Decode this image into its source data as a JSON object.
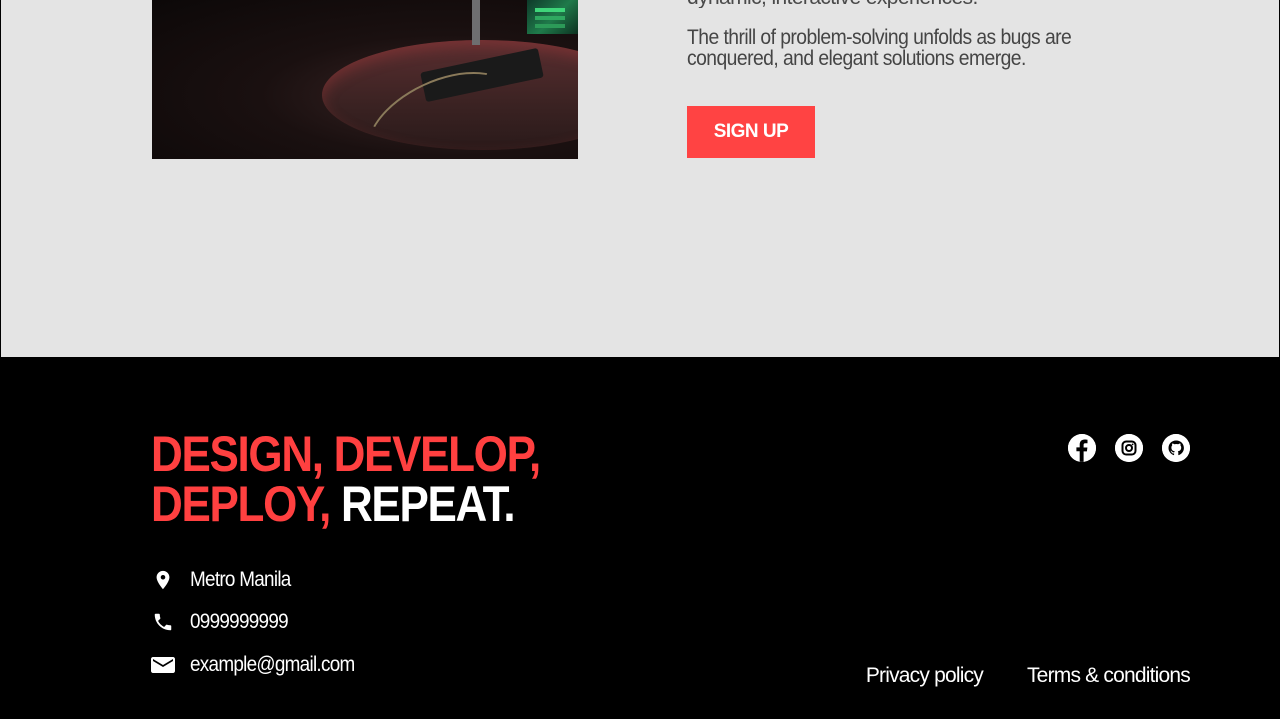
{
  "content": {
    "paragraph_cut": "dynamic, interactive experiences.",
    "paragraph": "The thrill of problem-solving unfolds as bugs are conquered, and elegant solutions emerge.",
    "signup_label": "SIGN UP"
  },
  "footer": {
    "tagline_red_1": "DESIGN, DEVELOP,",
    "tagline_red_2": "DEPLOY,",
    "tagline_white": "REPEAT.",
    "location": "Metro Manila",
    "phone": "0999999999",
    "email": "example@gmail.com",
    "privacy_label": "Privacy policy",
    "terms_label": "Terms & conditions",
    "socials": [
      "facebook-icon",
      "instagram-icon",
      "github-icon"
    ]
  },
  "colors": {
    "accent": "#ff4343",
    "upper_bg": "#e4e4e4",
    "footer_bg": "#000000",
    "text_dark": "#454545"
  }
}
